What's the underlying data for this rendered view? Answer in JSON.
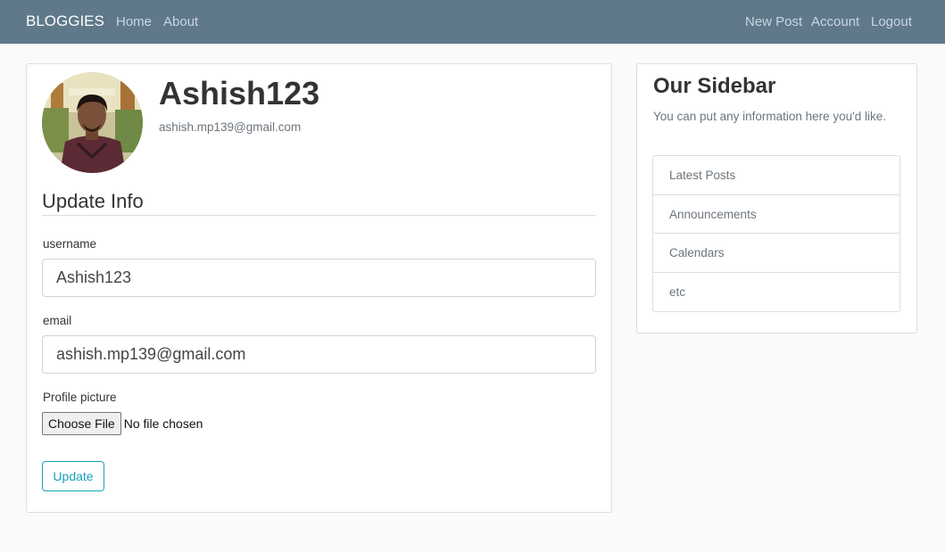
{
  "navbar": {
    "brand": "BLOGGIES",
    "links": [
      {
        "label": "Home"
      },
      {
        "label": "About"
      },
      {
        "label": "New Post"
      },
      {
        "label": "Account"
      },
      {
        "label": "Logout"
      }
    ]
  },
  "profile": {
    "username": "Ashish123",
    "email": "ashish.mp139@gmail.com"
  },
  "form": {
    "legend": "Update Info",
    "username_label": "username",
    "username_value": "Ashish123",
    "email_label": "email",
    "email_value": "ashish.mp139@gmail.com",
    "picture_label": "Profile picture",
    "file_button": "Choose File",
    "file_status": "No file chosen",
    "submit": "Update"
  },
  "sidebar": {
    "title": "Our Sidebar",
    "text": "You can put any information here you'd like.",
    "items": [
      {
        "label": "Latest Posts"
      },
      {
        "label": "Announcements"
      },
      {
        "label": "Calendars"
      },
      {
        "label": "etc"
      }
    ]
  },
  "colors": {
    "navbar": "#5f788a",
    "accent": "#17a2b8",
    "background": "#fafafa"
  }
}
